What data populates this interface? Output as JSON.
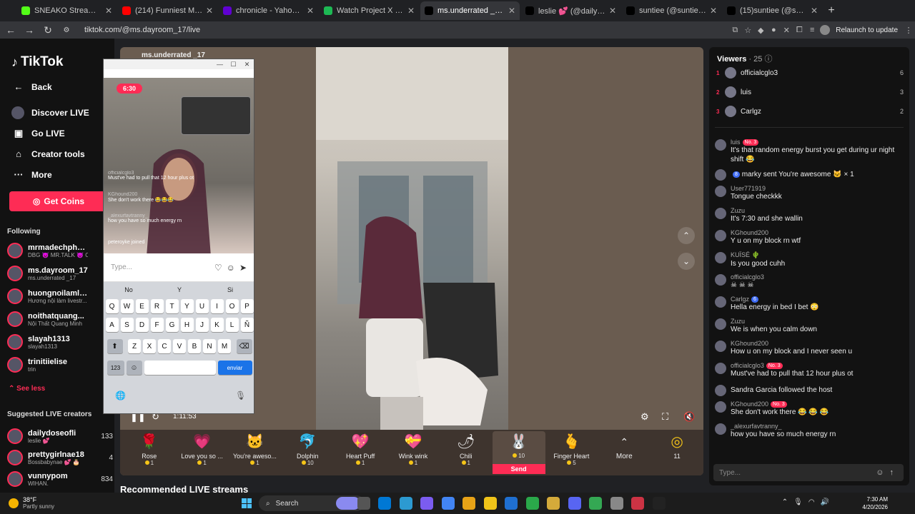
{
  "browser": {
    "tabs": [
      {
        "title": "SNEAKO Stream - Watch",
        "color": "#53fc18",
        "active": false
      },
      {
        "title": "(214) Funniest Moments o",
        "color": "#ff0000",
        "active": false
      },
      {
        "title": "chronicle - Yahoo Search",
        "color": "#6001d2",
        "active": false
      },
      {
        "title": "Watch Project X (2012) Fu",
        "color": "#1db954",
        "active": false
      },
      {
        "title": "ms.underrated _17 (@",
        "color": "#000000",
        "active": true
      },
      {
        "title": "leslie 💕 (@dailydoseofli",
        "color": "#000000",
        "active": false
      },
      {
        "title": "suntiee (@suntiee) is LIVE",
        "color": "#000000",
        "active": false
      },
      {
        "title": "(15)suntiee (@suntiee) | T",
        "color": "#000000",
        "active": false
      }
    ],
    "url": "tiktok.com/@ms.dayroom_17/live",
    "relaunch": "Relaunch to update"
  },
  "sidebar": {
    "logo": "TikTok",
    "back": "Back",
    "discover": "Discover LIVE",
    "golive": "Go LIVE",
    "creator_tools": "Creator tools",
    "more": "More",
    "get_coins": "Get Coins",
    "following_title": "Following",
    "following": [
      {
        "name": "mrmadechpha...",
        "sub": "DBG 😈 MR.TALK 😈 O..."
      },
      {
        "name": "ms.dayroom_17",
        "sub": "ms.underrated _17"
      },
      {
        "name": "huongnoilamli...",
        "sub": "Hương nội làm livestr..."
      },
      {
        "name": "noithatquang...",
        "sub": "Nội Thất Quang Minh"
      },
      {
        "name": "slayah1313",
        "sub": "slayah1313"
      },
      {
        "name": "trinitiielise",
        "sub": "trin"
      }
    ],
    "see_less": "See less",
    "suggested_title": "Suggested LIVE creators",
    "suggested": [
      {
        "name": "dailydoseofli",
        "sub": "leslie 💕",
        "count": "133"
      },
      {
        "name": "prettygirlnae18",
        "sub": "Bossbabynae 💕 🎂",
        "count": "4"
      },
      {
        "name": "vunnypom",
        "sub": "WIHAN.",
        "count": "834"
      }
    ]
  },
  "stage": {
    "host": "ms.underrated _17",
    "time": "1:11:53",
    "gifts": [
      {
        "name": "Rose",
        "price": "1",
        "icon": "🌹"
      },
      {
        "name": "Love you so ...",
        "price": "1",
        "icon": "💗"
      },
      {
        "name": "You're aweso...",
        "price": "1",
        "icon": "🐱"
      },
      {
        "name": "Dolphin",
        "price": "10",
        "icon": "🐬"
      },
      {
        "name": "Heart Puff",
        "price": "1",
        "icon": "💖"
      },
      {
        "name": "Wink wink",
        "price": "1",
        "icon": "💝"
      },
      {
        "name": "Chili",
        "price": "1",
        "icon": "🌶"
      },
      {
        "name": "",
        "price": "10",
        "icon": "🐰",
        "selected": true
      },
      {
        "name": "Finger Heart",
        "price": "5",
        "icon": "🫰"
      }
    ],
    "send": "Send",
    "more": "More",
    "coins": "11",
    "recommended": "Recommended LIVE streams"
  },
  "phone": {
    "time": "6:30",
    "comments": [
      {
        "user": "officialcglo3",
        "text": "Must've had to pull that 12 hour plus ot"
      },
      {
        "user": "KGhound200",
        "text": "She don't work there 😂😂😂"
      },
      {
        "user": "_alexurfavtranny_",
        "text": "how you have so much energy rn"
      },
      {
        "user": "",
        "text": "peteroyke joined"
      }
    ],
    "placeholder": "Type...",
    "suggestions": [
      "No",
      "Y",
      "Si"
    ],
    "row1": [
      "Q",
      "W",
      "E",
      "R",
      "T",
      "Y",
      "U",
      "I",
      "O",
      "P"
    ],
    "row2": [
      "A",
      "S",
      "D",
      "F",
      "G",
      "H",
      "J",
      "K",
      "L",
      "Ñ"
    ],
    "row3": [
      "Z",
      "X",
      "C",
      "V",
      "B",
      "N",
      "M"
    ],
    "num_key": "123",
    "send_key": "enviar"
  },
  "viewers": {
    "title": "Viewers",
    "count": "· 25",
    "top": [
      {
        "rank": "1",
        "name": "officialcglo3",
        "score": "6"
      },
      {
        "rank": "2",
        "name": "luis",
        "score": "3"
      },
      {
        "rank": "3",
        "name": "Carlgz",
        "score": "2"
      }
    ]
  },
  "chat": [
    {
      "name": "luis",
      "badge": "No. 3",
      "text": "It's that random energy burst you get during ur night shift 😂"
    },
    {
      "inline": "marky sent You're awesome 🐱 × 1",
      "badge": "8"
    },
    {
      "name": "User771919",
      "text": "Tongue checkkk"
    },
    {
      "name": "Zuzu",
      "text": "It's 7:30 and she wallin"
    },
    {
      "name": "KGhound200",
      "text": "Y u on my block rn wtf"
    },
    {
      "name": "KUÏSÉ 🌵",
      "text": "Is you good cuhh"
    },
    {
      "name": "officialcglo3",
      "text": "☠ ☠ ☠"
    },
    {
      "name": "Carlgz",
      "badge": "6",
      "text": "Hella energy in bed I bet 😳"
    },
    {
      "name": "Zuzu",
      "text": "We is when you calm down"
    },
    {
      "name": "KGhound200",
      "text": "How u on my block and I never seen u"
    },
    {
      "name": "officialcglo3",
      "badge": "No. 3",
      "text": "Must've had to pull that 12 hour plus ot"
    },
    {
      "inline": "Sandra Garcia  followed the host"
    },
    {
      "name": "KGhound200",
      "badge": "No. 3",
      "text": "She don't work there 😂 😂 😂"
    },
    {
      "name": "_alexurfavtranny_",
      "text": "how you have so much energy rn"
    }
  ],
  "chat_input_placeholder": "Type...",
  "taskbar": {
    "temp": "38°F",
    "weather": "Partly sunny",
    "search": "Search",
    "time": "7:30 AM",
    "date": "4/20/2026"
  }
}
